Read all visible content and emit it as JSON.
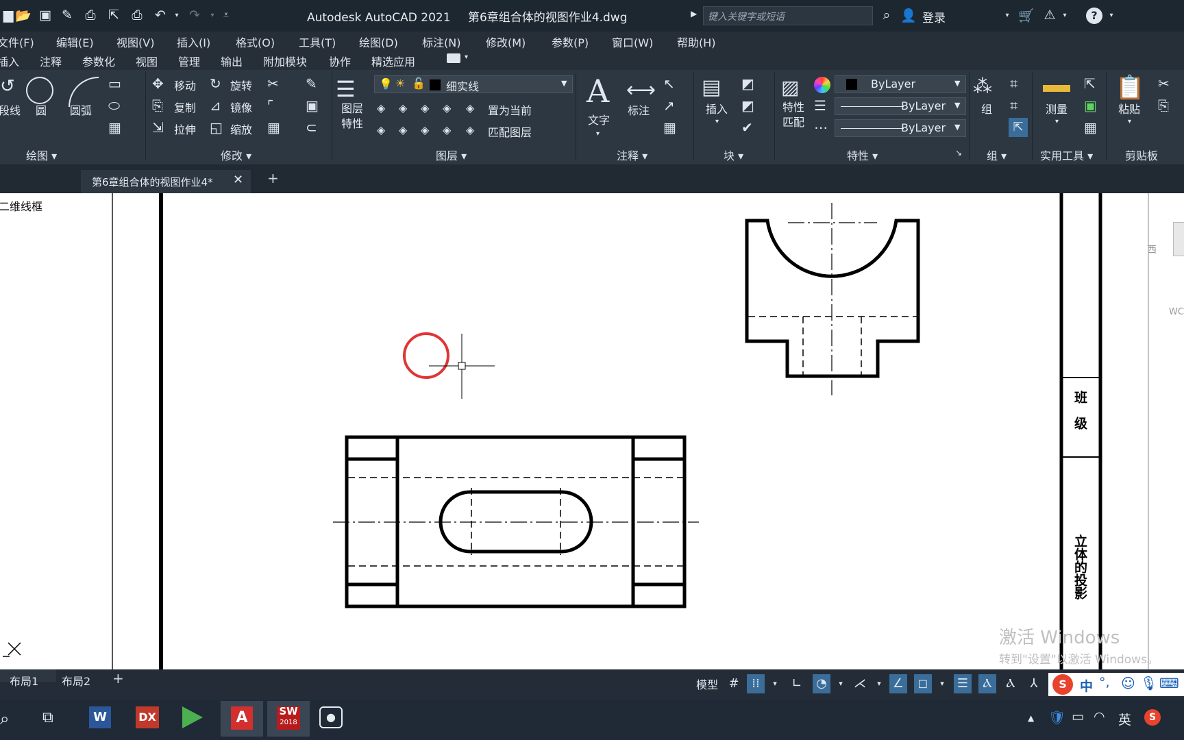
{
  "app": {
    "title": "Autodesk AutoCAD 2021",
    "document": "第6章组合体的视图作业4.dwg",
    "search_placeholder": "键入关键字或短语",
    "login": "登录"
  },
  "menu": [
    "文件(F)",
    "编辑(E)",
    "视图(V)",
    "插入(I)",
    "格式(O)",
    "工具(T)",
    "绘图(D)",
    "标注(N)",
    "修改(M)",
    "参数(P)",
    "窗口(W)",
    "帮助(H)"
  ],
  "ribbon_tabs": [
    "插入",
    "注释",
    "参数化",
    "视图",
    "管理",
    "输出",
    "附加模块",
    "协作",
    "精选应用"
  ],
  "ribbon": {
    "draw": {
      "title": "绘图",
      "polyline": "段线",
      "circle": "圆",
      "arc": "圆弧"
    },
    "modify": {
      "title": "修改",
      "move": "移动",
      "rotate": "旋转",
      "copy": "复制",
      "mirror": "镜像",
      "stretch": "拉伸",
      "scale": "缩放"
    },
    "layer": {
      "title": "图层",
      "properties": "图层\n特性",
      "layer_name": "细实线",
      "set_current": "置为当前",
      "match_layer": "匹配图层"
    },
    "annotation": {
      "title": "注释",
      "text": "文字",
      "dimension": "标注"
    },
    "block": {
      "title": "块",
      "insert": "插入"
    },
    "properties": {
      "title": "特性",
      "match": "特性\n匹配",
      "color": "ByLayer",
      "linetype": "ByLayer",
      "lineweight": "ByLayer"
    },
    "groups": {
      "title": "组",
      "group": "组"
    },
    "utilities": {
      "title": "实用工具",
      "measure": "测量"
    },
    "clipboard": {
      "title": "剪贴板",
      "paste": "粘贴"
    }
  },
  "doc_tab": {
    "label": "第6章组合体的视图作业4*"
  },
  "viewport_label": "二维线框",
  "title_block": {
    "class_label": "班  级",
    "subject_label": "立体的投影"
  },
  "layout_tabs": [
    "布局1",
    "布局2"
  ],
  "status": {
    "model": "模型"
  },
  "watermark": {
    "line1": "激活 Windows",
    "line2": "转到\"设置\"以激活 Windows。"
  },
  "viewcube": {
    "west": "西",
    "wcs": "WC"
  },
  "ime": {
    "lang": "中",
    "tray_lang": "英"
  },
  "taskbar": {
    "sw_badge": "2018"
  }
}
